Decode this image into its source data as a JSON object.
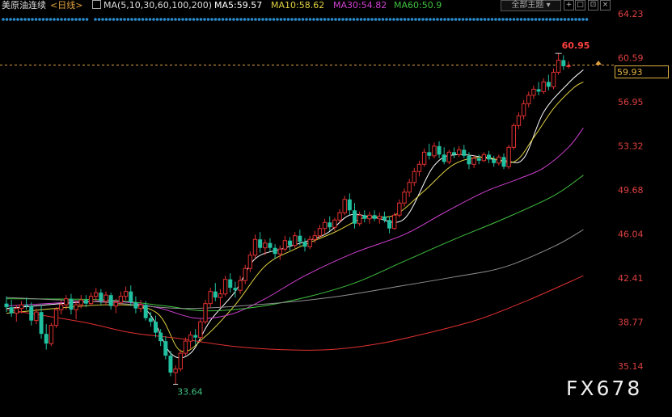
{
  "header": {
    "instrument": "美原油连续",
    "period": "<日线>",
    "ma_params": "MA(5,10,30,60,100,200)",
    "ma5": "MA5:59.57",
    "ma10": "MA10:58.62",
    "ma30": "MA30:54.82",
    "ma60": "MA60:50.9",
    "themes_button": "全部主题",
    "icons": [
      "chevron-down-icon",
      "zoom-in-icon",
      "fullscreen-icon",
      "close-icon"
    ]
  },
  "price_box": "59.93",
  "watermark": "FX678",
  "colors": {
    "up": "#e03030",
    "down": "#20c0a0",
    "ma5": "#ffffff",
    "ma10": "#e0d040",
    "ma30": "#d040d0",
    "ma60": "#40c040",
    "ma100": "#909090",
    "ma200": "#e03030",
    "axis_text": "#e04040",
    "current_line": "#e0a040"
  },
  "chart_data": {
    "type": "candlestick",
    "y_ticks": [
      "64.23",
      "60.59",
      "56.95",
      "53.32",
      "49.68",
      "46.04",
      "42.41",
      "38.77",
      "35.14"
    ],
    "ylim": [
      33.0,
      64.8
    ],
    "annotations": {
      "high": "60.95",
      "low": "33.64"
    },
    "candles": [
      [
        40.3,
        40.9,
        39.6,
        40.0
      ],
      [
        40.0,
        40.6,
        39.2,
        39.5
      ],
      [
        39.5,
        40.2,
        38.8,
        39.9
      ],
      [
        39.9,
        40.5,
        39.5,
        40.2
      ],
      [
        40.2,
        40.8,
        39.8,
        40.1
      ],
      [
        40.1,
        40.4,
        38.5,
        38.9
      ],
      [
        38.9,
        39.9,
        38.6,
        39.6
      ],
      [
        39.6,
        40.2,
        37.4,
        37.8
      ],
      [
        37.8,
        38.6,
        36.5,
        37.0
      ],
      [
        37.0,
        38.7,
        36.8,
        38.5
      ],
      [
        38.5,
        40.0,
        38.3,
        39.8
      ],
      [
        39.8,
        40.6,
        39.4,
        40.2
      ],
      [
        40.2,
        41.0,
        39.8,
        40.7
      ],
      [
        40.7,
        41.1,
        39.4,
        39.8
      ],
      [
        39.8,
        40.5,
        39.0,
        40.2
      ],
      [
        40.2,
        41.0,
        39.9,
        40.6
      ],
      [
        40.6,
        41.0,
        40.0,
        40.3
      ],
      [
        40.3,
        41.2,
        40.1,
        40.9
      ],
      [
        40.9,
        41.6,
        40.5,
        41.2
      ],
      [
        41.2,
        41.5,
        40.2,
        40.5
      ],
      [
        40.5,
        41.3,
        40.2,
        41.0
      ],
      [
        41.0,
        41.2,
        39.8,
        40.1
      ],
      [
        40.1,
        40.7,
        39.5,
        40.4
      ],
      [
        40.4,
        41.3,
        40.2,
        40.9
      ],
      [
        40.9,
        41.7,
        40.6,
        41.3
      ],
      [
        41.3,
        41.8,
        40.1,
        40.4
      ],
      [
        40.4,
        40.9,
        39.5,
        39.9
      ],
      [
        39.9,
        40.6,
        39.6,
        40.2
      ],
      [
        40.2,
        40.5,
        38.9,
        39.1
      ],
      [
        39.1,
        39.6,
        38.4,
        38.8
      ],
      [
        38.8,
        39.3,
        37.5,
        37.9
      ],
      [
        37.9,
        38.2,
        36.8,
        37.2
      ],
      [
        37.2,
        37.6,
        35.7,
        36.0
      ],
      [
        36.0,
        36.4,
        34.3,
        34.6
      ],
      [
        34.6,
        35.2,
        33.64,
        34.9
      ],
      [
        34.9,
        36.5,
        34.7,
        36.2
      ],
      [
        36.2,
        37.5,
        36.0,
        37.2
      ],
      [
        37.2,
        38.0,
        36.6,
        37.7
      ],
      [
        37.7,
        38.2,
        36.9,
        37.5
      ],
      [
        37.5,
        39.0,
        37.3,
        38.8
      ],
      [
        38.8,
        40.6,
        38.6,
        40.3
      ],
      [
        40.3,
        41.6,
        40.0,
        41.3
      ],
      [
        41.3,
        42.0,
        40.5,
        40.8
      ],
      [
        40.8,
        41.5,
        40.0,
        41.1
      ],
      [
        41.1,
        42.6,
        40.9,
        42.3
      ],
      [
        42.3,
        42.8,
        41.2,
        41.6
      ],
      [
        41.6,
        42.1,
        40.8,
        41.4
      ],
      [
        41.4,
        42.6,
        41.1,
        42.2
      ],
      [
        42.2,
        43.5,
        41.9,
        43.2
      ],
      [
        43.2,
        44.6,
        42.9,
        44.3
      ],
      [
        44.3,
        46.0,
        44.0,
        45.6
      ],
      [
        45.6,
        46.2,
        44.5,
        44.9
      ],
      [
        44.9,
        45.6,
        44.3,
        45.3
      ],
      [
        45.3,
        45.7,
        44.6,
        44.9
      ],
      [
        44.9,
        45.2,
        44.0,
        44.4
      ],
      [
        44.4,
        45.1,
        43.9,
        44.8
      ],
      [
        44.8,
        45.9,
        44.6,
        45.5
      ],
      [
        45.5,
        45.8,
        44.7,
        45.1
      ],
      [
        45.1,
        46.2,
        44.9,
        45.9
      ],
      [
        45.9,
        46.4,
        45.1,
        45.4
      ],
      [
        45.4,
        45.7,
        44.6,
        45.0
      ],
      [
        45.0,
        45.9,
        44.8,
        45.6
      ],
      [
        45.6,
        46.3,
        45.3,
        45.9
      ],
      [
        45.9,
        46.8,
        45.7,
        46.5
      ],
      [
        46.5,
        47.3,
        46.0,
        47.0
      ],
      [
        47.0,
        47.5,
        46.3,
        46.6
      ],
      [
        46.6,
        47.4,
        46.3,
        47.2
      ],
      [
        47.2,
        48.1,
        47.0,
        47.8
      ],
      [
        47.8,
        49.2,
        47.6,
        48.9
      ],
      [
        48.9,
        49.4,
        47.6,
        48.0
      ],
      [
        48.0,
        48.6,
        46.5,
        46.9
      ],
      [
        46.9,
        47.9,
        46.7,
        47.6
      ],
      [
        47.6,
        48.0,
        47.0,
        47.3
      ],
      [
        47.3,
        47.9,
        46.9,
        47.6
      ],
      [
        47.6,
        48.0,
        47.1,
        47.3
      ],
      [
        47.3,
        47.8,
        46.9,
        47.5
      ],
      [
        47.5,
        47.9,
        47.0,
        47.2
      ],
      [
        47.2,
        47.5,
        46.1,
        46.5
      ],
      [
        46.5,
        47.8,
        46.4,
        47.6
      ],
      [
        47.6,
        48.9,
        47.4,
        48.6
      ],
      [
        48.6,
        49.8,
        48.3,
        49.5
      ],
      [
        49.5,
        50.6,
        49.1,
        50.3
      ],
      [
        50.3,
        51.5,
        50.0,
        51.2
      ],
      [
        51.2,
        52.1,
        50.8,
        51.8
      ],
      [
        51.8,
        53.1,
        51.6,
        52.8
      ],
      [
        52.8,
        53.5,
        52.2,
        52.5
      ],
      [
        52.5,
        53.6,
        52.3,
        53.3
      ],
      [
        53.3,
        53.7,
        52.3,
        52.6
      ],
      [
        52.6,
        53.2,
        51.8,
        52.0
      ],
      [
        52.0,
        53.0,
        51.8,
        52.8
      ],
      [
        52.8,
        53.2,
        52.3,
        52.6
      ],
      [
        52.6,
        53.3,
        52.4,
        53.0
      ],
      [
        53.0,
        53.4,
        52.3,
        52.5
      ],
      [
        52.5,
        52.8,
        51.4,
        51.8
      ],
      [
        51.8,
        52.5,
        51.5,
        52.3
      ],
      [
        52.3,
        52.6,
        51.8,
        52.1
      ],
      [
        52.1,
        52.8,
        52.0,
        52.6
      ],
      [
        52.6,
        52.9,
        51.9,
        52.2
      ],
      [
        52.2,
        52.5,
        51.6,
        51.9
      ],
      [
        51.9,
        52.6,
        51.7,
        52.4
      ],
      [
        52.4,
        52.7,
        51.4,
        51.6
      ],
      [
        51.6,
        53.4,
        51.4,
        53.2
      ],
      [
        53.2,
        55.2,
        53.0,
        55.0
      ],
      [
        55.0,
        56.1,
        54.7,
        55.8
      ],
      [
        55.8,
        57.1,
        55.5,
        56.8
      ],
      [
        56.8,
        57.8,
        56.5,
        57.5
      ],
      [
        57.5,
        58.3,
        57.2,
        58.0
      ],
      [
        58.0,
        58.6,
        57.5,
        57.8
      ],
      [
        57.8,
        58.9,
        57.6,
        58.6
      ],
      [
        58.6,
        59.2,
        57.9,
        58.2
      ],
      [
        58.2,
        59.7,
        58.0,
        59.4
      ],
      [
        59.4,
        60.95,
        59.2,
        60.4
      ],
      [
        60.4,
        60.8,
        59.6,
        59.9
      ],
      [
        59.9,
        60.3,
        59.7,
        59.93
      ]
    ],
    "ma_lines": [
      {
        "name": "MA5",
        "color": "#ffffff",
        "values": [
          [
            0,
            39.9
          ],
          [
            20,
            40.5
          ],
          [
            28,
            39.8
          ],
          [
            33,
            36.2
          ],
          [
            37,
            36.2
          ],
          [
            41,
            38.9
          ],
          [
            46,
            41.3
          ],
          [
            50,
            44.0
          ],
          [
            56,
            44.9
          ],
          [
            64,
            46.0
          ],
          [
            69,
            47.6
          ],
          [
            74,
            47.4
          ],
          [
            80,
            47.3
          ],
          [
            86,
            51.7
          ],
          [
            91,
            52.6
          ],
          [
            100,
            52.1
          ],
          [
            104,
            52.3
          ],
          [
            108,
            56.1
          ],
          [
            113,
            58.5
          ],
          [
            116,
            59.6
          ]
        ]
      },
      {
        "name": "MA10",
        "color": "#e0d040",
        "values": [
          [
            0,
            39.5
          ],
          [
            20,
            40.2
          ],
          [
            30,
            39.6
          ],
          [
            35,
            36.4
          ],
          [
            40,
            37.6
          ],
          [
            46,
            40.2
          ],
          [
            52,
            43.4
          ],
          [
            58,
            44.8
          ],
          [
            66,
            46.2
          ],
          [
            72,
            47.4
          ],
          [
            78,
            47.6
          ],
          [
            84,
            49.6
          ],
          [
            90,
            51.8
          ],
          [
            96,
            52.4
          ],
          [
            102,
            52.0
          ],
          [
            106,
            54.0
          ],
          [
            110,
            56.4
          ],
          [
            114,
            58.1
          ],
          [
            116,
            58.6
          ]
        ]
      },
      {
        "name": "MA30",
        "color": "#d040d0",
        "values": [
          [
            0,
            40.1
          ],
          [
            20,
            40.5
          ],
          [
            30,
            40.0
          ],
          [
            38,
            39.1
          ],
          [
            45,
            39.4
          ],
          [
            52,
            40.7
          ],
          [
            60,
            42.6
          ],
          [
            70,
            44.5
          ],
          [
            80,
            46.0
          ],
          [
            88,
            47.8
          ],
          [
            96,
            49.5
          ],
          [
            103,
            50.6
          ],
          [
            108,
            51.5
          ],
          [
            113,
            53.2
          ],
          [
            116,
            54.8
          ]
        ]
      },
      {
        "name": "MA60",
        "color": "#40c040",
        "values": [
          [
            0,
            40.7
          ],
          [
            20,
            40.6
          ],
          [
            32,
            40.1
          ],
          [
            40,
            39.7
          ],
          [
            50,
            40.0
          ],
          [
            60,
            40.8
          ],
          [
            70,
            42.0
          ],
          [
            80,
            43.8
          ],
          [
            90,
            45.6
          ],
          [
            100,
            47.3
          ],
          [
            110,
            49.2
          ],
          [
            116,
            50.9
          ]
        ]
      },
      {
        "name": "MA100",
        "color": "#909090",
        "values": [
          [
            0,
            40.8
          ],
          [
            20,
            40.4
          ],
          [
            35,
            39.9
          ],
          [
            50,
            40.2
          ],
          [
            65,
            40.8
          ],
          [
            80,
            41.8
          ],
          [
            90,
            42.5
          ],
          [
            100,
            43.3
          ],
          [
            110,
            45.0
          ],
          [
            116,
            46.4
          ]
        ]
      },
      {
        "name": "MA200",
        "color": "#e03030",
        "values": [
          [
            0,
            39.8
          ],
          [
            15,
            38.8
          ],
          [
            25,
            37.9
          ],
          [
            35,
            37.4
          ],
          [
            45,
            36.8
          ],
          [
            55,
            36.5
          ],
          [
            65,
            36.5
          ],
          [
            75,
            37.0
          ],
          [
            85,
            37.9
          ],
          [
            95,
            39.0
          ],
          [
            105,
            40.6
          ],
          [
            116,
            42.6
          ]
        ]
      }
    ]
  }
}
